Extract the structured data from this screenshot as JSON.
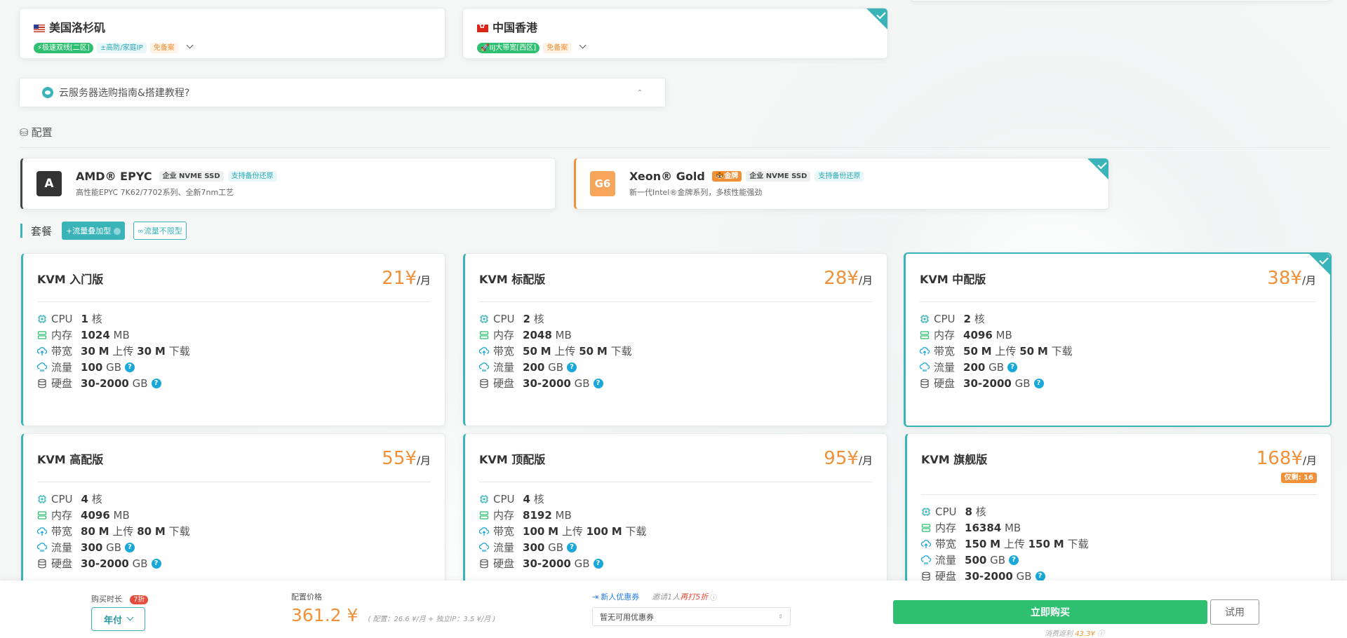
{
  "regions": [
    {
      "name": "美国洛杉矶",
      "tags": [
        "⚡极速双线[二区]",
        "±高防/家庭IP",
        "免备案"
      ]
    },
    {
      "name": "中国香港",
      "tags": [
        "🚀IIJ大带宽[西区]",
        "免备案"
      ],
      "selected": true
    }
  ],
  "guide": {
    "text": "云服务器选购指南&搭建教程?"
  },
  "config": {
    "section_title": "配置",
    "options": [
      {
        "logo": "A",
        "name": "AMD® EPYC",
        "tags": [
          "企业 NVME SSD",
          "支持备份还原"
        ],
        "desc": "高性能EPYC 7K62/7702系列、全新7nm工艺"
      },
      {
        "logo": "G6",
        "name": "Xeon® Gold",
        "tags": [
          "🐯金牌",
          "企业 NVME SSD",
          "支持备份还原"
        ],
        "desc": "新一代Intel®金牌系列，多核性能强劲",
        "selected": true
      }
    ]
  },
  "packages": {
    "section_title": "套餐",
    "tabs": [
      "+流量叠加型",
      "∞流量不限型"
    ]
  },
  "labels": {
    "cpu": "CPU",
    "mem": "内存",
    "bw": "带宽",
    "traffic": "流量",
    "disk": "硬盘",
    "core": "核",
    "mb": "MB",
    "gb": "GB",
    "up": "上传",
    "down": "下载",
    "m": "M",
    "per_month": "/月",
    "yuan": "¥"
  },
  "plans": [
    {
      "name": "KVM 入门版",
      "price": "21",
      "cpu": "1",
      "mem": "1024",
      "up": "30",
      "down": "30",
      "traffic": "100",
      "disk": "30-2000"
    },
    {
      "name": "KVM 标配版",
      "price": "28",
      "cpu": "2",
      "mem": "2048",
      "up": "50",
      "down": "50",
      "traffic": "200",
      "disk": "30-2000"
    },
    {
      "name": "KVM 中配版",
      "price": "38",
      "cpu": "2",
      "mem": "4096",
      "up": "50",
      "down": "50",
      "traffic": "200",
      "disk": "30-2000",
      "selected": true
    },
    {
      "name": "KVM 高配版",
      "price": "55",
      "cpu": "4",
      "mem": "4096",
      "up": "80",
      "down": "80",
      "traffic": "300",
      "disk": "30-2000"
    },
    {
      "name": "KVM 顶配版",
      "price": "95",
      "cpu": "4",
      "mem": "8192",
      "up": "100",
      "down": "100",
      "traffic": "300",
      "disk": "30-2000"
    },
    {
      "name": "KVM 旗舰版",
      "price": "168",
      "cpu": "8",
      "mem": "16384",
      "up": "150",
      "down": "150",
      "traffic": "500",
      "disk": "30-2000",
      "stock": "仅剩: 16"
    }
  ],
  "bottom": {
    "duration_label": "购买时长",
    "discount": "7折",
    "duration_value": "年付",
    "price_label": "配置价格",
    "price": "361.2 ¥",
    "price_detail": "( 配置：26.6 ¥/月 + 独立IP：3.5 ¥/月 )",
    "coupon_link": "新人优惠券",
    "invite": "邀请1人",
    "invite_extra": "再打5折",
    "coupon_placeholder": "暂无可用优惠券",
    "buy": "立即购买",
    "trial": "试用",
    "rebate_label": "消费返利",
    "rebate_value": "43.3¥"
  },
  "colors": {
    "accent": "#3bb4b9",
    "price": "#f0913a",
    "buy": "#2fbf71"
  }
}
